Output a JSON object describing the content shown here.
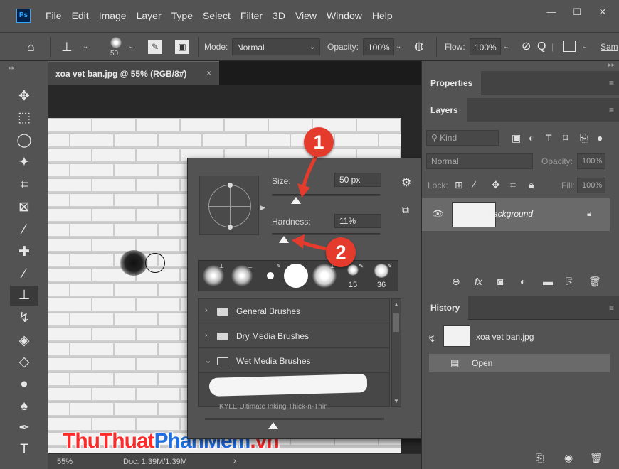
{
  "app": {
    "logo": "Ps"
  },
  "menu": [
    "File",
    "Edit",
    "Image",
    "Layer",
    "Type",
    "Select",
    "Filter",
    "3D",
    "View",
    "Window",
    "Help"
  ],
  "window_controls": [
    "—",
    "☐",
    "✕"
  ],
  "options_bar": {
    "brush_size": "50",
    "mode_label": "Mode:",
    "mode_value": "Normal",
    "opacity_label": "Opacity:",
    "opacity_value": "100%",
    "flow_label": "Flow:",
    "flow_value": "100%",
    "sample_label": "Sam"
  },
  "document": {
    "tab_title": "xoa vet ban.jpg @ 55% (RGB/8#)",
    "close": "×",
    "zoom": "55%",
    "doc_info": "Doc: 1.39M/1.39M",
    "status_arrow": "›"
  },
  "brush_popup": {
    "size_label": "Size:",
    "size_value": "50 px",
    "hardness_label": "Hardness:",
    "hardness_value": "11%",
    "size_level_percent": 14,
    "hardness_level_percent": 11,
    "preset_numbers": [
      "15",
      "36"
    ],
    "folders": [
      {
        "name": "General Brushes",
        "expanded": false
      },
      {
        "name": "Dry Media Brushes",
        "expanded": false
      },
      {
        "name": "Wet Media Brushes",
        "expanded": true
      }
    ],
    "stroke_caption": "KYLE Ultimate Inking Thick-n-Thin"
  },
  "annotations": {
    "badge1": "1",
    "badge2": "2",
    "color": "#e53b2c"
  },
  "panels": {
    "properties_tab": "Properties",
    "layers_tab": "Layers",
    "kind_placeholder": "Kind",
    "blend_mode": "Normal",
    "opacity_label": "Opacity:",
    "opacity_value": "100%",
    "lock_label": "Lock:",
    "fill_label": "Fill:",
    "fill_value": "100%",
    "layer_name": "Background",
    "history_tab": "History",
    "history_snapshot": "xoa vet ban.jpg",
    "history_state": "Open"
  },
  "watermark": {
    "part1": "ThuThuat",
    "part2": "PhanMem",
    "part3": ".vn"
  },
  "colors": {
    "ui_bg": "#535353",
    "canvas_bg": "#282828",
    "accent_red": "#e53b2c",
    "brand_blue": "#31a8ff"
  }
}
